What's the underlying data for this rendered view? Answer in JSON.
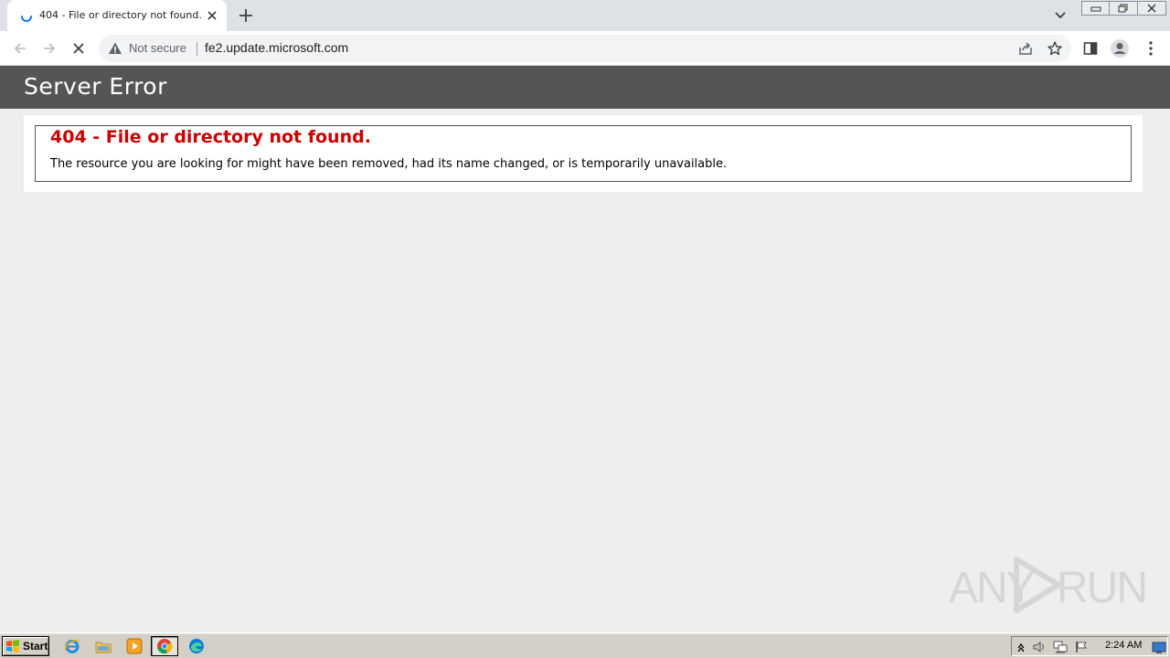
{
  "browser": {
    "tab": {
      "title": "404 - File or directory not found."
    },
    "address_bar": {
      "security_label": "Not secure",
      "url": "fe2.update.microsoft.com"
    }
  },
  "page": {
    "header_title": "Server Error",
    "error_heading": "404 - File or directory not found.",
    "error_message": "The resource you are looking for might have been removed, had its name changed, or is temporarily unavailable."
  },
  "watermark": {
    "left_text": "ANY",
    "right_text": "RUN"
  },
  "taskbar": {
    "start_label": "Start",
    "clock": "2:24 AM"
  },
  "colors": {
    "header_bg": "#555555",
    "error_red": "#cc0000",
    "page_bg": "#eeeeee",
    "loading_blue": "#1a73e8"
  }
}
